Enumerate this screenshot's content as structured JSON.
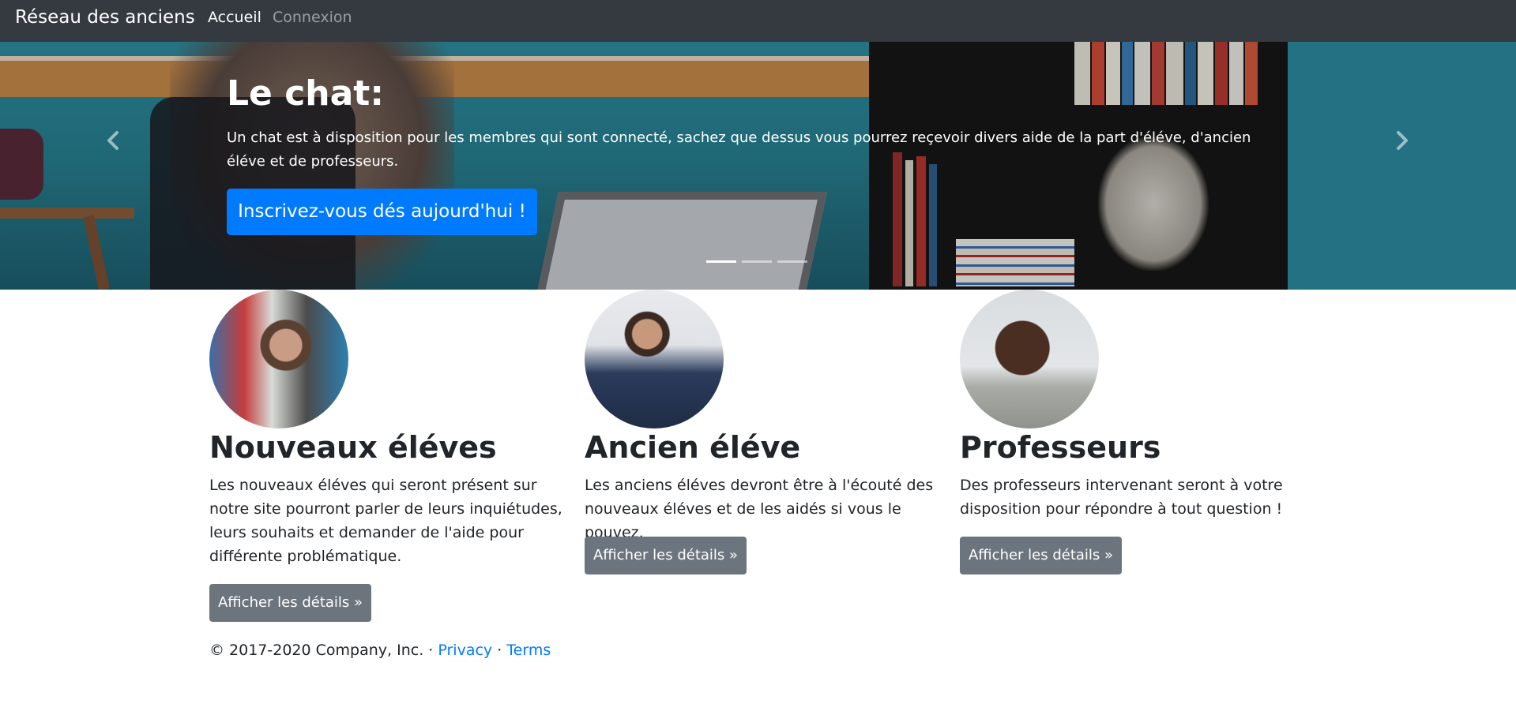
{
  "navbar": {
    "brand": "Réseau des anciens",
    "links": [
      {
        "label": "Accueil"
      },
      {
        "label": "Connexion"
      }
    ]
  },
  "carousel": {
    "title": "Le chat:",
    "text": "Un chat est à disposition pour les membres qui sont connecté, sachez que dessus vous pourrez reçevoir divers aide de la part d'éléve, d'ancien éléve et de professeurs.",
    "cta": "Inscrivez-vous dés aujourd'hui !",
    "prev_icon": "chevron-left-icon",
    "next_icon": "chevron-right-icon",
    "slide_count": 3,
    "active_slide": 1
  },
  "columns": [
    {
      "title": "Nouveaux éléves",
      "text": "Les nouveaux éléves qui seront présent sur notre site pourront parler de leurs inquiétudes, leurs souhaits et demander de l'aide pour différente problématique.",
      "button": "Afficher les détails »"
    },
    {
      "title": "Ancien éléve",
      "text": "Les anciens éléves devront être à l'écouté des nouveaux éléves et de les aidés si vous le pouvez.",
      "button": "Afficher les détails »"
    },
    {
      "title": "Professeurs",
      "text": "Des professeurs intervenant seront à votre disposition pour répondre à tout question !",
      "button": "Afficher les détails »"
    }
  ],
  "footer": {
    "copyright": "© 2017-2020 Company, Inc. · ",
    "privacy": "Privacy",
    "separator": " · ",
    "terms": "Terms"
  },
  "colors": {
    "navbar": "#343a40",
    "primary": "#007bff",
    "secondary": "#6c757d"
  }
}
